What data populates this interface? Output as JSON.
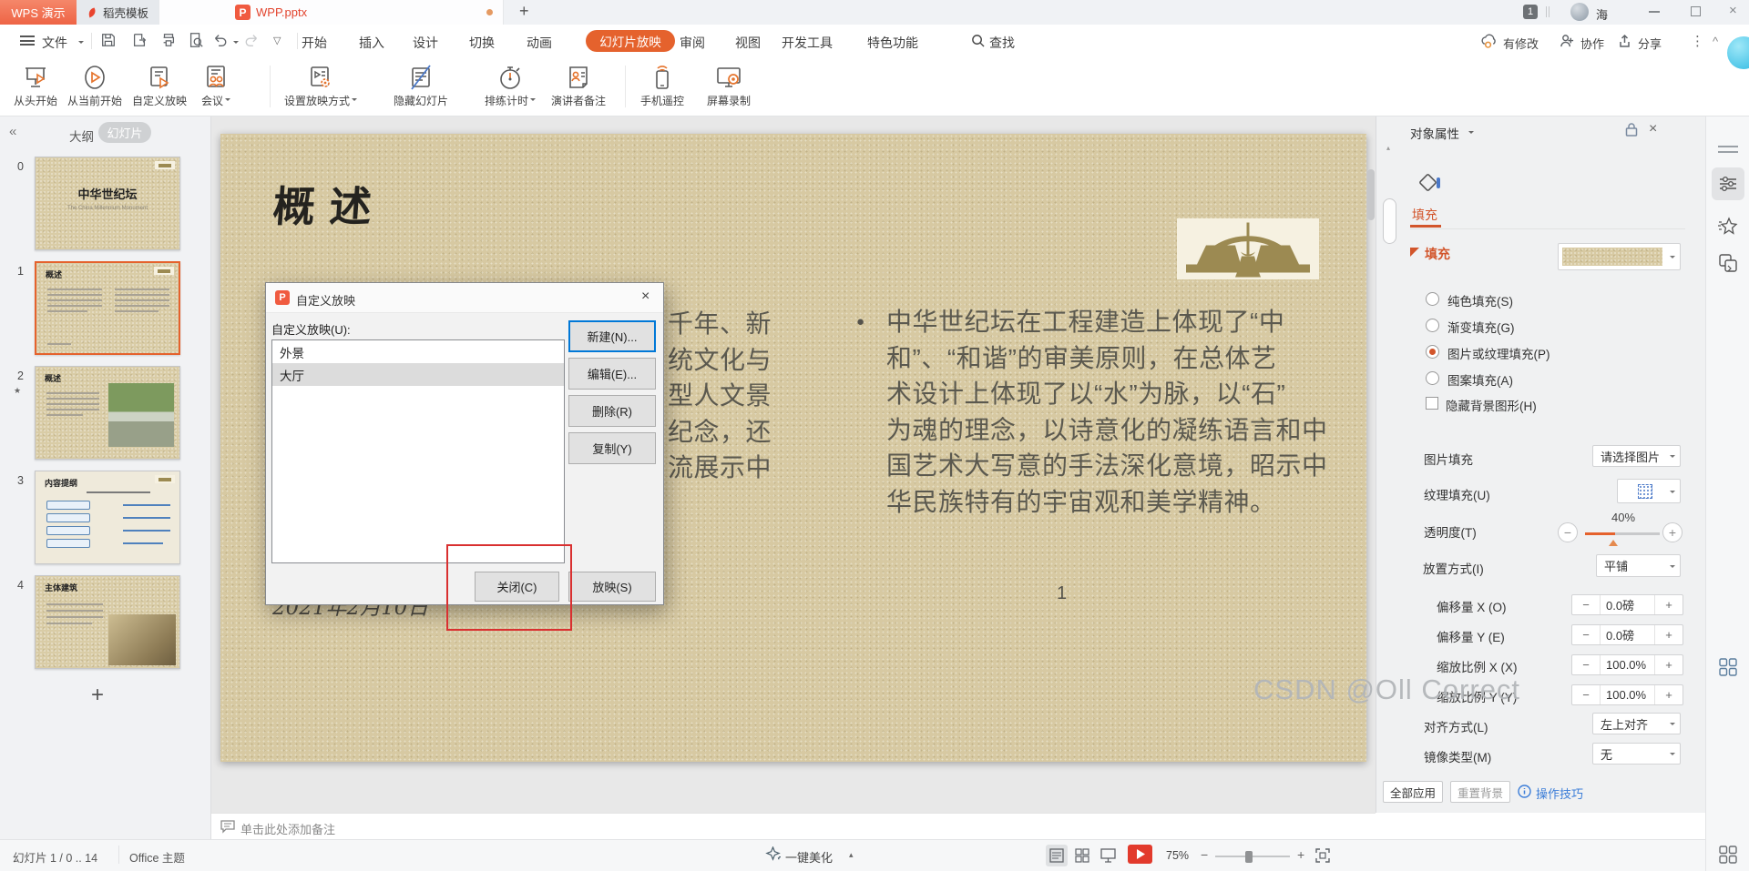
{
  "glyphs": {
    "collapse": "«",
    "caret": "▾",
    "caret_up": "▴",
    "tri_down": "▽",
    "plus": "+",
    "minus": "−",
    "times": "×",
    "dots": "⋮",
    "chevron": "^",
    "star": "★",
    "bullet": "●",
    "wpp": "P",
    "pct40_marker": "▲",
    "chev_small": "⌄"
  },
  "titlebar": {
    "app_tab": "WPS 演示",
    "store_tab": "稻壳模板",
    "doc_tab": "WPP.pptx",
    "badge": "1",
    "user": "海"
  },
  "menubar": {
    "file_label": "文件",
    "items": [
      "开始",
      "插入",
      "设计",
      "切换",
      "动画",
      "幻灯片放映",
      "审阅",
      "视图",
      "开发工具",
      "特色功能"
    ],
    "active_item": "幻灯片放映",
    "find_label": "查找",
    "modified_label": "有修改",
    "collab_label": "协作",
    "share_label": "分享"
  },
  "ribbon": {
    "buttons": [
      {
        "label": "从头开始"
      },
      {
        "label": "从当前开始"
      },
      {
        "label": "自定义放映"
      },
      {
        "label": "会议"
      },
      {
        "label": "设置放映方式"
      },
      {
        "label": "隐藏幻灯片"
      },
      {
        "label": "排练计时"
      },
      {
        "label": "演讲者备注"
      },
      {
        "label": "手机遥控"
      },
      {
        "label": "屏幕录制"
      }
    ]
  },
  "slide_panel": {
    "outline_tab": "大纲",
    "slides_tab": "幻灯片",
    "add_label": "+",
    "thumbnails": [
      {
        "num": "0",
        "title": "中华世纪坛",
        "subtitle": "The China Millennium Monument"
      },
      {
        "num": "1",
        "title": "概述"
      },
      {
        "num": "2",
        "title": "概述"
      },
      {
        "num": "3",
        "title": "内容提纲"
      },
      {
        "num": "4",
        "title": "主体建筑"
      }
    ]
  },
  "slide": {
    "title": "概 述",
    "left_fragments": [
      "千年、新",
      "统文化与",
      "型人文景",
      "纪念，还",
      "流展示中"
    ],
    "right_lines": [
      "中华世纪坛在工程建造上体现了“中",
      "和”、“和谐”的审美原则，在总体艺",
      "术设计上体现了以“水”为脉，以“石”",
      "为魂的理念，以诗意化的凝练语言和中",
      "国艺术大写意的手法深化意境，昭示中",
      "华民族特有的宇宙观和美学精神。"
    ],
    "date": "2021年2月10日",
    "page_number": "1"
  },
  "dialog": {
    "title": "自定义放映",
    "list_label": "自定义放映(U):",
    "items": [
      "外景",
      "大厅"
    ],
    "selected_item": "大厅",
    "new_btn": "新建(N)...",
    "edit_btn": "编辑(E)...",
    "delete_btn": "删除(R)",
    "copy_btn": "复制(Y)",
    "close_btn": "关闭(C)",
    "show_btn": "放映(S)"
  },
  "properties": {
    "title": "对象属性",
    "tab": "填充",
    "section": "填充",
    "radios": [
      {
        "label": "纯色填充(S)"
      },
      {
        "label": "渐变填充(G)"
      },
      {
        "label": "图片或纹理填充(P)"
      },
      {
        "label": "图案填充(A)"
      }
    ],
    "selected_radio": "图片或纹理填充(P)",
    "checkbox_label": "隐藏背景图形(H)",
    "picture_fill_label": "图片填充",
    "picture_fill_value": "请选择图片",
    "texture_fill_label": "纹理填充(U)",
    "transparency_label": "透明度(T)",
    "transparency_value": "40%",
    "placement_label": "放置方式(I)",
    "placement_value": "平铺",
    "offset_x_label": "偏移量 X (O)",
    "offset_x_value": "0.0磅",
    "offset_y_label": "偏移量 Y (E)",
    "offset_y_value": "0.0磅",
    "scale_x_label": "缩放比例 X (X)",
    "scale_x_value": "100.0%",
    "scale_y_label": "缩放比例 Y (Y)",
    "scale_y_value": "100.0%",
    "align_label": "对齐方式(L)",
    "align_value": "左上对齐",
    "mirror_label": "镜像类型(M)",
    "mirror_value": "无",
    "apply_all_btn": "全部应用",
    "reset_bg_btn": "重置背景",
    "tips_link": "操作技巧"
  },
  "notes_bar": {
    "placeholder": "单击此处添加备注"
  },
  "status_bar": {
    "slide_info": "幻灯片 1 / 0 .. 14",
    "theme": "Office 主题",
    "beautify": "一键美化",
    "zoom_level": "75%"
  },
  "watermark": "CSDN @Oll Correct",
  "colors": {
    "accent_orange": "#e5622d",
    "wps_red": "#f05b40",
    "focus_blue": "#0078d7",
    "annotation_red": "#d93030",
    "slide_bg": "#d7c9a2",
    "gold": "#9c8a52"
  }
}
